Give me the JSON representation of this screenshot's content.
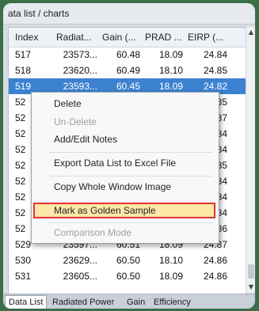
{
  "window": {
    "title": "ata list / charts"
  },
  "table": {
    "headers": [
      "Index",
      "Radiat...",
      "Gain (...",
      "PRAD ...",
      "EIRP (..."
    ],
    "rows": [
      [
        "517",
        "23573...",
        "60.48",
        "18.09",
        "24.84"
      ],
      [
        "518",
        "23620...",
        "60.49",
        "18.10",
        "24.85"
      ],
      [
        "519",
        "23593...",
        "60.45",
        "18.09",
        "24.82"
      ],
      [
        "52",
        "",
        "",
        "",
        "24.85"
      ],
      [
        "52",
        "",
        "",
        "",
        "24.87"
      ],
      [
        "52",
        "",
        "",
        "",
        "24.84"
      ],
      [
        "52",
        "",
        "",
        "",
        "24.84"
      ],
      [
        "52",
        "",
        "",
        "",
        "24.85"
      ],
      [
        "52",
        "",
        "",
        "",
        "24.84"
      ],
      [
        "52",
        "",
        "",
        "",
        "24.84"
      ],
      [
        "52",
        "",
        "",
        "",
        "24.84"
      ],
      [
        "52",
        "",
        "",
        "",
        "24.86"
      ],
      [
        "529",
        "23597...",
        "60.51",
        "18.09",
        "24.87"
      ],
      [
        "530",
        "23629...",
        "60.50",
        "18.10",
        "24.86"
      ],
      [
        "531",
        "23605...",
        "60.50",
        "18.09",
        "24.86"
      ]
    ],
    "selected_row": 2
  },
  "context_menu": {
    "items": [
      {
        "label": "Delete",
        "enabled": true
      },
      {
        "label": "Un-Delete",
        "enabled": false
      },
      {
        "label": "Add/Edit Notes",
        "enabled": true
      },
      {
        "label": "Export Data List to Excel File",
        "enabled": true
      },
      {
        "label": "Copy Whole Window Image",
        "enabled": true
      },
      {
        "label": "Mark as Golden Sample",
        "enabled": true,
        "highlighted": true
      },
      {
        "label": "Comparison Mode",
        "enabled": false
      }
    ]
  },
  "tabs": [
    "Data List",
    "Radiated Power",
    "Gain",
    "Efficiency"
  ],
  "active_tab": "Data List",
  "colors": {
    "selection": "#3d82d0",
    "highlight_border": "#e53232",
    "highlight_fill": "#fde8a8",
    "frame_background": "#3b6f48"
  }
}
